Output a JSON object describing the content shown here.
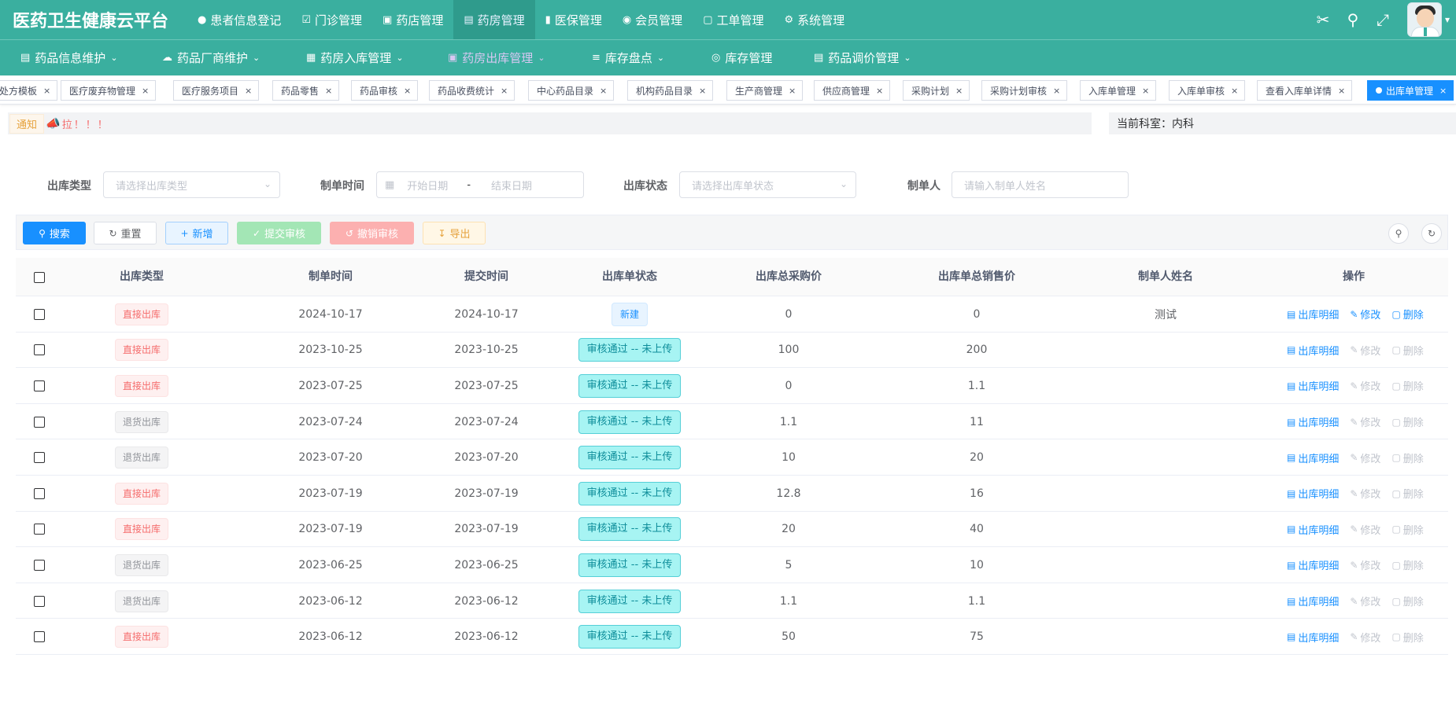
{
  "app": {
    "title": "医药卫生健康云平台"
  },
  "top_nav": [
    {
      "label": "患者信息登记",
      "icon": "user-icon"
    },
    {
      "label": "门诊管理",
      "icon": "thumb-icon"
    },
    {
      "label": "药店管理",
      "icon": "store-icon"
    },
    {
      "label": "药房管理",
      "icon": "pharmacy-icon",
      "active": true
    },
    {
      "label": "医保管理",
      "icon": "book-icon"
    },
    {
      "label": "会员管理",
      "icon": "github-icon"
    },
    {
      "label": "工单管理",
      "icon": "ticket-icon"
    },
    {
      "label": "系统管理",
      "icon": "gear-icon"
    }
  ],
  "sub_nav": [
    {
      "label": "药品信息维护"
    },
    {
      "label": "药品厂商维护"
    },
    {
      "label": "药房入库管理"
    },
    {
      "label": "药房出库管理",
      "active": true
    },
    {
      "label": "库存盘点"
    },
    {
      "label": "库存管理"
    },
    {
      "label": "药品调价管理"
    }
  ],
  "tags": [
    {
      "label": "处方模板"
    },
    {
      "label": "医疗废弃物管理"
    },
    {
      "label": "医疗服务项目"
    },
    {
      "label": "药品零售"
    },
    {
      "label": "药品审核"
    },
    {
      "label": "药品收费统计"
    },
    {
      "label": "中心药品目录"
    },
    {
      "label": "机构药品目录"
    },
    {
      "label": "生产商管理"
    },
    {
      "label": "供应商管理"
    },
    {
      "label": "采购计划"
    },
    {
      "label": "采购计划审核"
    },
    {
      "label": "入库单管理"
    },
    {
      "label": "入库单审核"
    },
    {
      "label": "查看入库单详情"
    },
    {
      "label": "出库单管理",
      "active": true
    }
  ],
  "notice": {
    "badge": "通知",
    "text": "拉！！！"
  },
  "department": {
    "label": "当前科室：",
    "value": "内科"
  },
  "search": {
    "type_label": "出库类型",
    "type_placeholder": "请选择出库类型",
    "time_label": "制单时间",
    "start_placeholder": "开始日期",
    "range_sep": "-",
    "end_placeholder": "结束日期",
    "status_label": "出库状态",
    "status_placeholder": "请选择出库单状态",
    "creator_label": "制单人",
    "creator_placeholder": "请输入制单人姓名"
  },
  "toolbar": {
    "search": "搜索",
    "reset": "重置",
    "add": "新增",
    "submit": "提交审核",
    "revoke": "撤销审核",
    "export": "导出"
  },
  "table": {
    "headers": [
      "出库类型",
      "制单时间",
      "提交时间",
      "出库单状态",
      "出库总采购价",
      "出库单总销售价",
      "制单人姓名",
      "操作"
    ],
    "ops": {
      "detail": "出库明细",
      "edit": "修改",
      "delete": "删除"
    },
    "rows": [
      {
        "type": "直接出库",
        "type_color": "red",
        "created": "2024-10-17",
        "submitted": "2024-10-17",
        "status": "新建",
        "status_kind": "new",
        "purchase": "0",
        "sale": "0",
        "creator": "测试",
        "editable": true
      },
      {
        "type": "直接出库",
        "type_color": "red",
        "created": "2023-10-25",
        "submitted": "2023-10-25",
        "status": "审核通过 -- 未上传",
        "status_kind": "ok",
        "purchase": "100",
        "sale": "200",
        "creator": "",
        "editable": false
      },
      {
        "type": "直接出库",
        "type_color": "red",
        "created": "2023-07-25",
        "submitted": "2023-07-25",
        "status": "审核通过 -- 未上传",
        "status_kind": "ok",
        "purchase": "0",
        "sale": "1.1",
        "creator": "",
        "editable": false
      },
      {
        "type": "退货出库",
        "type_color": "gray",
        "created": "2023-07-24",
        "submitted": "2023-07-24",
        "status": "审核通过 -- 未上传",
        "status_kind": "ok",
        "purchase": "1.1",
        "sale": "11",
        "creator": "",
        "editable": false
      },
      {
        "type": "退货出库",
        "type_color": "gray",
        "created": "2023-07-20",
        "submitted": "2023-07-20",
        "status": "审核通过 -- 未上传",
        "status_kind": "ok",
        "purchase": "10",
        "sale": "20",
        "creator": "",
        "editable": false
      },
      {
        "type": "直接出库",
        "type_color": "red",
        "created": "2023-07-19",
        "submitted": "2023-07-19",
        "status": "审核通过 -- 未上传",
        "status_kind": "ok",
        "purchase": "12.8",
        "sale": "16",
        "creator": "",
        "editable": false
      },
      {
        "type": "直接出库",
        "type_color": "red",
        "created": "2023-07-19",
        "submitted": "2023-07-19",
        "status": "审核通过 -- 未上传",
        "status_kind": "ok",
        "purchase": "20",
        "sale": "40",
        "creator": "",
        "editable": false
      },
      {
        "type": "退货出库",
        "type_color": "gray",
        "created": "2023-06-25",
        "submitted": "2023-06-25",
        "status": "审核通过 -- 未上传",
        "status_kind": "ok",
        "purchase": "5",
        "sale": "10",
        "creator": "",
        "editable": false
      },
      {
        "type": "退货出库",
        "type_color": "gray",
        "created": "2023-06-12",
        "submitted": "2023-06-12",
        "status": "审核通过 -- 未上传",
        "status_kind": "ok",
        "purchase": "1.1",
        "sale": "1.1",
        "creator": "",
        "editable": false
      },
      {
        "type": "直接出库",
        "type_color": "red",
        "created": "2023-06-12",
        "submitted": "2023-06-12",
        "status": "审核通过 -- 未上传",
        "status_kind": "ok",
        "purchase": "50",
        "sale": "75",
        "creator": "",
        "editable": false
      }
    ]
  }
}
